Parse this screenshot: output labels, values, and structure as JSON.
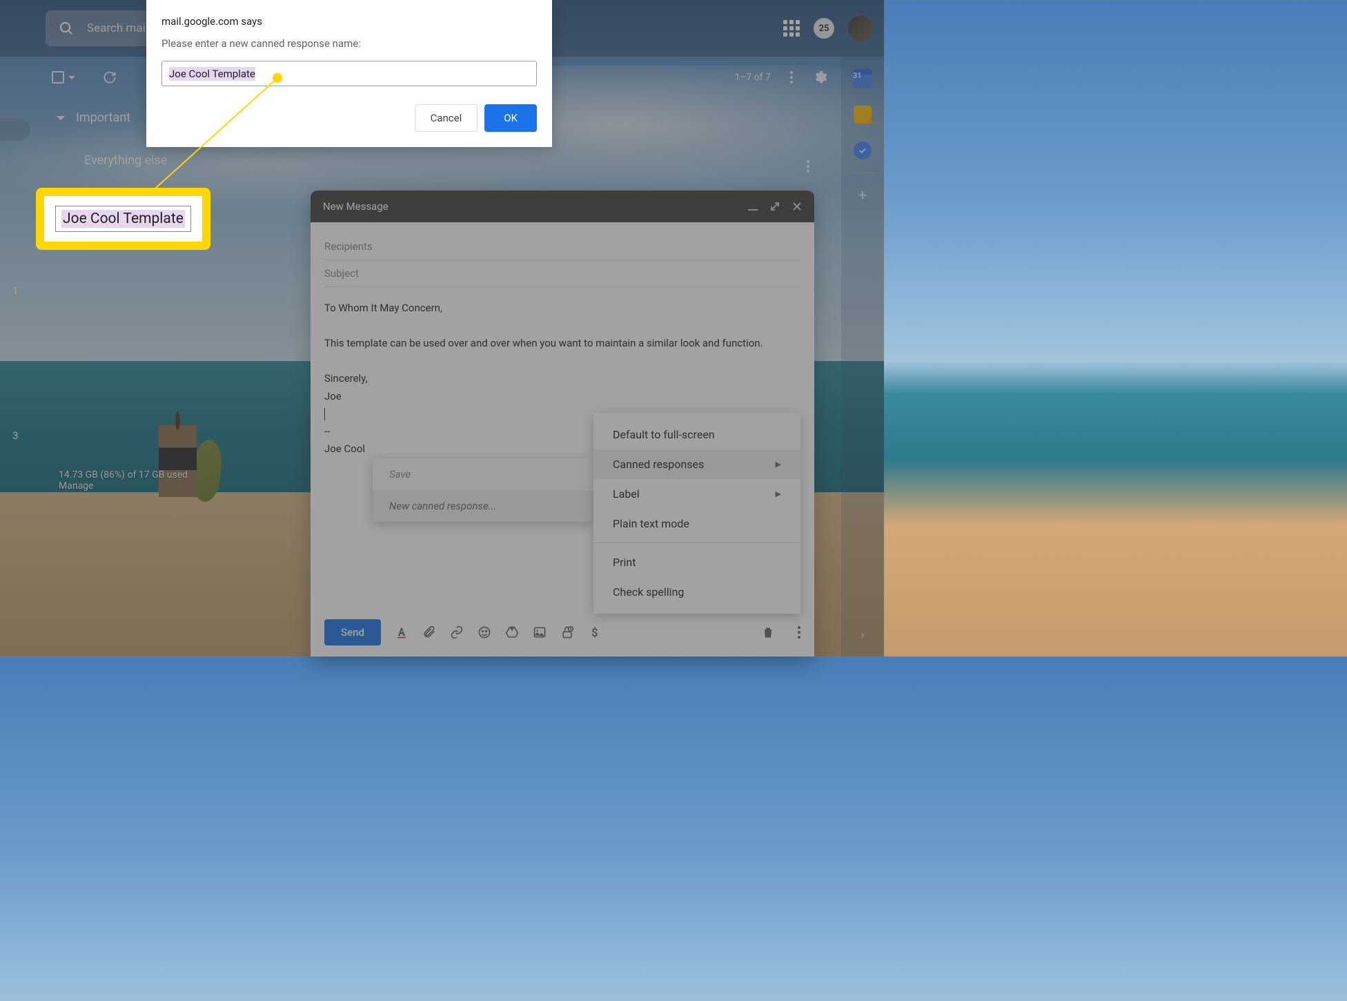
{
  "header": {
    "search_placeholder": "Search mail",
    "search_partial": "Search m",
    "badge": "25"
  },
  "toolbar": {
    "pagination": "1–7 of 7"
  },
  "sections": {
    "important": "Important",
    "everything": "Everything else"
  },
  "left_counts": {
    "c1": "1",
    "c3": "3"
  },
  "storage": {
    "line1": "14.73 GB (86%) of 17 GB used",
    "line2": "Manage"
  },
  "sidebar": {
    "calendar_day": "31"
  },
  "compose": {
    "title": "New Message",
    "recipients": "Recipients",
    "subject": "Subject",
    "body_greeting": "To Whom It May Concern,",
    "body_p1": "This template can be used over and over when you want to maintain a similar look and function.",
    "body_sincerely": "Sincerely,",
    "body_name": "Joe",
    "body_sep": "--",
    "body_sig": "Joe Cool",
    "send": "Send"
  },
  "submenu": {
    "save": "Save",
    "new_response": "New canned response..."
  },
  "menu": {
    "fullscreen": "Default to full-screen",
    "canned": "Canned responses",
    "label": "Label",
    "plaintext": "Plain text mode",
    "print": "Print",
    "spelling": "Check spelling"
  },
  "dialog": {
    "title": "mail.google.com says",
    "prompt": "Please enter a new canned response name:",
    "input_value": "Joe Cool Template",
    "cancel": "Cancel",
    "ok": "OK"
  },
  "callout": {
    "text": "Joe Cool Template"
  }
}
